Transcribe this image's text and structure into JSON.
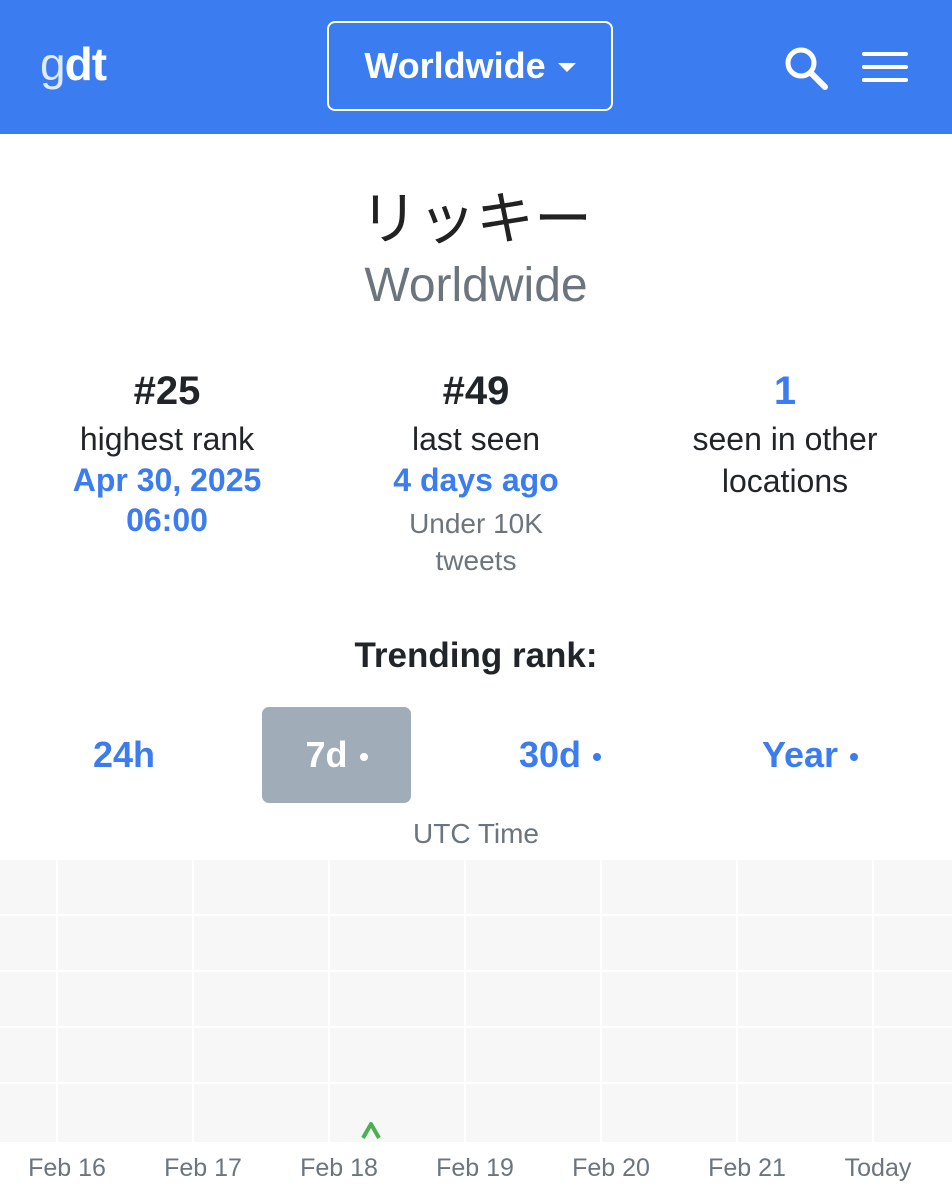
{
  "header": {
    "logo_light": "g",
    "logo_bold": "dt",
    "location_label": "Worldwide",
    "brand_color": "#3b7cf0",
    "icons": [
      "search-icon",
      "hamburger-menu-icon",
      "chevron-down-icon"
    ]
  },
  "trend": {
    "title": "リッキー",
    "location": "Worldwide"
  },
  "stats": {
    "highest": {
      "rank": "#25",
      "label": "highest rank",
      "date_line1": "Apr 30, 2025",
      "date_line2": "06:00"
    },
    "last": {
      "rank": "#49",
      "label": "last seen",
      "when": "4 days ago",
      "note_line1": "Under 10K",
      "note_line2": "tweets"
    },
    "other": {
      "count": "1",
      "label_line1": "seen in other",
      "label_line2": "locations"
    }
  },
  "trending_rank": {
    "heading": "Trending rank:",
    "tabs": [
      {
        "label": "24h",
        "dot": false,
        "active": false
      },
      {
        "label": "7d",
        "dot": true,
        "active": true
      },
      {
        "label": "30d",
        "dot": true,
        "active": false
      },
      {
        "label": "Year",
        "dot": true,
        "active": false
      }
    ],
    "timezone_label": "UTC Time"
  },
  "chart_data": {
    "type": "line",
    "xlabel": "UTC Time",
    "categories": [
      "Feb 16",
      "Feb 17",
      "Feb 18",
      "Feb 19",
      "Feb 20",
      "Feb 21",
      "Today"
    ],
    "grid": true,
    "series": [
      {
        "x": [
          "Feb 18"
        ],
        "values": [
          49
        ],
        "color": "#4caf50"
      }
    ]
  }
}
